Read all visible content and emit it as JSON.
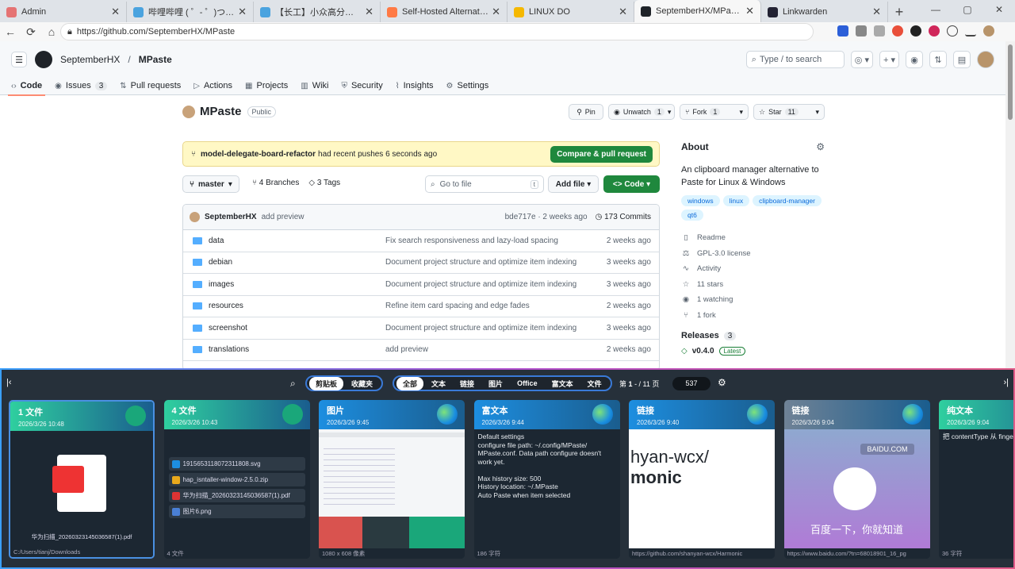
{
  "browser": {
    "tabs": [
      {
        "title": "Admin",
        "color": "#e57373"
      },
      {
        "title": "哔哩哔哩 ( ゜- ゜)つロ 干杯~-bilibili",
        "color": "#4aa3df"
      },
      {
        "title": "【长工】小众高分美剧，人死后会...",
        "color": "#4aa3df"
      },
      {
        "title": "Self-Hosted Alternatives to Popular...",
        "color": "#ff7a45"
      },
      {
        "title": "LINUX DO",
        "color": "#f5b800"
      },
      {
        "title": "SeptemberHX/MPaste: An clipboard...",
        "color": "#1f2328"
      },
      {
        "title": "Linkwarden",
        "color": "#223"
      }
    ],
    "active_tab": 5,
    "url": "https://github.com/SeptemberHX/MPaste"
  },
  "github": {
    "owner": "SeptemberHX",
    "sep": "/",
    "repo": "MPaste",
    "search_placeholder": "Type / to search",
    "nav": [
      {
        "label": "Code",
        "count": ""
      },
      {
        "label": "Issues",
        "count": "3"
      },
      {
        "label": "Pull requests",
        "count": ""
      },
      {
        "label": "Actions",
        "count": ""
      },
      {
        "label": "Projects",
        "count": ""
      },
      {
        "label": "Wiki",
        "count": ""
      },
      {
        "label": "Security",
        "count": ""
      },
      {
        "label": "Insights",
        "count": ""
      },
      {
        "label": "Settings",
        "count": ""
      }
    ],
    "visibility": "Public",
    "actions": {
      "pin": "Pin",
      "unwatch": "Unwatch",
      "unwatch_n": "1",
      "fork": "Fork",
      "fork_n": "1",
      "star": "Star",
      "star_n": "11"
    },
    "notice": {
      "branch": "model-delegate-board-refactor",
      "text": "had recent pushes 6 seconds ago",
      "button": "Compare & pull request"
    },
    "branch": {
      "name": "master",
      "branches": "4 Branches",
      "tags": "3 Tags",
      "goto": "Go to file",
      "goto_key": "t",
      "addfile": "Add file",
      "code": "Code"
    },
    "commit": {
      "author": "SeptemberHX",
      "msg": "add preview",
      "hash": "bde717e · 2 weeks ago",
      "commits": "173 Commits"
    },
    "files": [
      {
        "name": "data",
        "msg": "Fix search responsiveness and lazy-load spacing",
        "date": "2 weeks ago"
      },
      {
        "name": "debian",
        "msg": "Document project structure and optimize item indexing",
        "date": "3 weeks ago"
      },
      {
        "name": "images",
        "msg": "Document project structure and optimize item indexing",
        "date": "3 weeks ago"
      },
      {
        "name": "resources",
        "msg": "Refine item card spacing and edge fades",
        "date": "2 weeks ago"
      },
      {
        "name": "screenshot",
        "msg": "Document project structure and optimize item indexing",
        "date": "3 weeks ago"
      },
      {
        "name": "translations",
        "msg": "add preview",
        "date": "2 weeks ago"
      }
    ],
    "about": {
      "title": "About",
      "desc": "An clipboard manager alternative to Paste for Linux & Windows",
      "topics": [
        "windows",
        "linux",
        "clipboard-manager",
        "qt6"
      ],
      "links": [
        "Readme",
        "GPL-3.0 license",
        "Activity",
        "11 stars",
        "1 watching",
        "1 fork"
      ],
      "releases": "Releases",
      "releases_n": "3",
      "latest_tag": "v0.4.0",
      "latest_label": "Latest"
    }
  },
  "mpaste": {
    "board_tabs": [
      "剪贴板",
      "收藏夹"
    ],
    "filters": [
      "全部",
      "文本",
      "链接",
      "图片",
      "Office",
      "富文本",
      "文件"
    ],
    "page_prefix": "第",
    "page": "1",
    "page_sep": "- / 11",
    "page_suffix": "页",
    "count": "537",
    "cards": [
      {
        "type": "1 文件",
        "time": "2026/3/26 10:48",
        "color": "#2fcf9f",
        "filename": "华为扫描_20260323145036587(1).pdf",
        "footer": "C:/Users/tianj/Downloads"
      },
      {
        "type": "4 文件",
        "time": "2026/3/26 10:43",
        "color": "#2fcf9f",
        "files": [
          "1915653118072311808.svg",
          "hap_isntaller-window-2.5.0.zip",
          "华为扫描_20260323145036587(1).pdf",
          "图片6.png"
        ],
        "footer": "4 文件"
      },
      {
        "type": "图片",
        "time": "2026/3/26 9:45",
        "color": "#1d8ee0",
        "footer": "1080 x 608 像素"
      },
      {
        "type": "富文本",
        "time": "2026/3/26 9:44",
        "color": "#1d8ee0",
        "lines": [
          "Default settings",
          "configure file path: ~/.config/MPaste/",
          "MPaste.conf. Data path configure doesn't",
          "work yet.",
          "",
          "Max history size: 500",
          "History location: ~/.MPaste",
          "Auto Paste when item selected"
        ],
        "footer": "186 字符"
      },
      {
        "type": "链接",
        "time": "2026/3/26 9:40",
        "color": "#1d8ee0",
        "preview1": "hyan-wcx/",
        "preview2": "monic",
        "footer": "https://github.com/shanyan-wcx/Harmonic"
      },
      {
        "type": "链接",
        "time": "2026/3/26 9:04",
        "color": "#6f8296",
        "preview1": "BAIDU.COM",
        "preview2": "百度一下，你就知道",
        "footer": "https://www.baidu.com/?tn=68018901_16_pg"
      },
      {
        "type": "纯文本",
        "time": "2026/3/26 9:04",
        "color": "#2fcf9f",
        "lines": [
          "把 contentType 从 fingerprint 旧"
        ],
        "footer": "36 字符"
      }
    ]
  }
}
